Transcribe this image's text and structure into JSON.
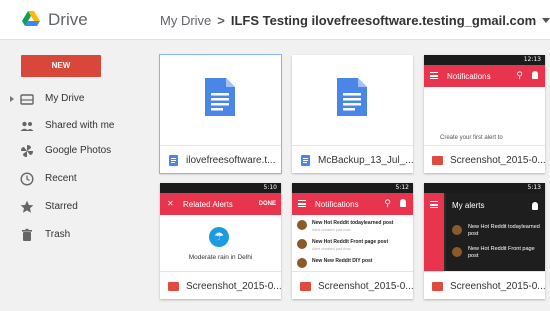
{
  "app": {
    "title": "Drive"
  },
  "breadcrumb": {
    "root": "My Drive",
    "separator": ">",
    "current": "ILFS Testing ilovefreesoftware.testing_gmail.com"
  },
  "new_button": {
    "label": "NEW"
  },
  "sidebar": {
    "items": [
      {
        "label": "My Drive",
        "icon": "drive-icon"
      },
      {
        "label": "Shared with me",
        "icon": "people-icon"
      },
      {
        "label": "Google Photos",
        "icon": "pinwheel-icon"
      },
      {
        "label": "Recent",
        "icon": "clock-icon"
      },
      {
        "label": "Starred",
        "icon": "star-icon"
      },
      {
        "label": "Trash",
        "icon": "trash-icon"
      }
    ]
  },
  "files": [
    {
      "name": "ilovefreesoftware.t...",
      "type": "doc"
    },
    {
      "name": "McBackup_13_Jul_...",
      "type": "doc"
    },
    {
      "name": "Screenshot_2015-0...",
      "type": "image"
    },
    {
      "name": "Screenshot_2015-0...",
      "type": "image"
    },
    {
      "name": "Screenshot_2015-0...",
      "type": "image"
    },
    {
      "name": "Screenshot_2015-0...",
      "type": "image"
    }
  ],
  "thumbs": {
    "notif1": {
      "status_time": "12:13",
      "title": "Notifications",
      "empty_text": "Create your first alert to"
    },
    "related": {
      "status_time": "5:10",
      "title": "Related Alerts",
      "done": "DONE",
      "weather": "Moderate rain in Delhi"
    },
    "notif2": {
      "status_time": "5:12",
      "title": "Notifications",
      "rows": [
        {
          "title": "New Hot Reddit todaylearned post",
          "sub": "Alert created just now"
        },
        {
          "title": "New Hot Reddit Front page post",
          "sub": "Alert created just now"
        },
        {
          "title": "New New Reddit DIY post",
          "sub": ""
        }
      ]
    },
    "alerts": {
      "status_time": "5:13",
      "title": "My alerts",
      "rows": [
        {
          "title": "New Hot Reddit todaylearned post"
        },
        {
          "title": "New Hot Reddit Front page post"
        }
      ]
    }
  },
  "colors": {
    "accent_red": "#e8344c",
    "new_button": "#d9473a",
    "doc_blue": "#4a86e8"
  }
}
